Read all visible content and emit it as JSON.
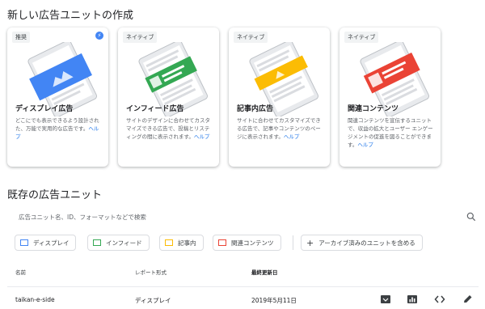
{
  "create_section": {
    "title": "新しい広告ユニットの作成",
    "cards": [
      {
        "badge": "推奨",
        "title": "ディスプレイ広告",
        "desc": "どこにでも表示できるよう設計された、万能で実用的な広告です。",
        "help": "ヘルプ"
      },
      {
        "badge": "ネイティブ",
        "title": "インフィード広告",
        "desc": "サイトのデザインに合わせてカスタマイズできる広告で、投稿とリスティングの間に表示されます。",
        "help": "ヘルプ"
      },
      {
        "badge": "ネイティブ",
        "title": "記事内広告",
        "desc": "サイトに合わせてカスタマイズできる広告で、記事やコンテンツのページに表示されます。",
        "help": "ヘルプ"
      },
      {
        "badge": "ネイティブ",
        "title": "関連コンテンツ",
        "desc": "関連コンテンツを宣伝するユニットで、収益の拡大とユーザー エンゲージメントの促進を図ることができます。",
        "help": "ヘルプ"
      }
    ]
  },
  "existing_section": {
    "title": "既存の広告ユニット",
    "search_placeholder": "広告ユニット名、ID、フォーマットなどで検索",
    "filters": [
      "ディスプレイ",
      "インフィード",
      "記事内",
      "関連コンテンツ"
    ],
    "archive_toggle": "アーカイブ済みのユニットを含める",
    "table": {
      "headers": {
        "name": "名前",
        "format": "レポート形式",
        "updated": "最終更新日"
      },
      "rows": [
        {
          "name": "taikan-e-side",
          "format": "ディスプレイ",
          "updated": "2019年5月11日"
        }
      ]
    }
  },
  "colors": {
    "display": "#4285f4",
    "infeed": "#34a853",
    "inarticle": "#fbbc04",
    "related": "#ea4335",
    "link": "#1a73e8"
  }
}
